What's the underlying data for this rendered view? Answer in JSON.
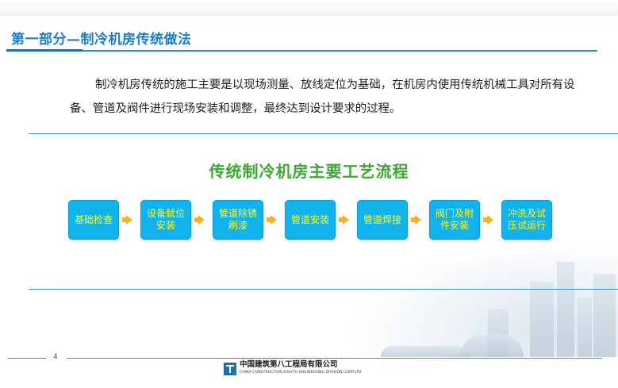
{
  "section_title": "第一部分—制冷机房传统做法",
  "intro": "制冷机房传统的施工主要是以现场测量、放线定位为基础，在机房内使用传统机械工具对所有设备、管道及阀件进行现场安装和调整，最终达到设计要求的过程。",
  "flow": {
    "title": "传统制冷机房主要工艺流程",
    "steps": [
      "基础检查",
      "设备就位安装",
      "管道除锈刷漆",
      "管道安装",
      "管道焊接",
      "阀门及附件安装",
      "冲洗及试压试运行"
    ]
  },
  "footer": {
    "page_number": "4",
    "company_cn": "中国建筑第八工程局有限公司",
    "company_en": "CHINA CONSTRUCTION EIGHTH ENGINEERING DIVISION CORP.LTD"
  },
  "colors": {
    "title_blue": "#1a7fc4",
    "flow_title_green": "#3fa535",
    "step_fill": "#12b3ec",
    "step_text": "#fdfa22",
    "arrow": "#f7b322"
  }
}
